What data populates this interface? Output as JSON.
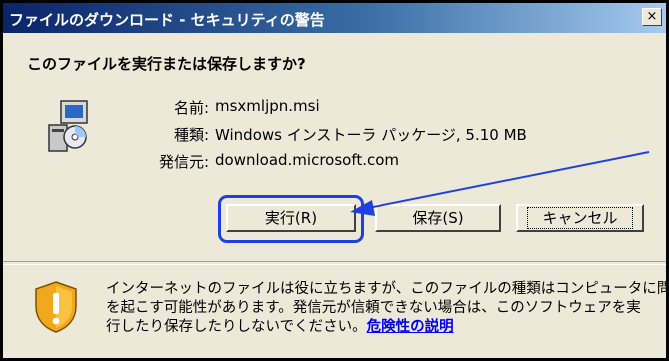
{
  "window": {
    "title": "ファイルのダウンロード - セキュリティの警告",
    "close_label": "×"
  },
  "dialog": {
    "question": "このファイルを実行または保存しますか?",
    "fields": [
      {
        "label": "名前:",
        "value": "msxmljpn.msi"
      },
      {
        "label": "種類:",
        "value": "Windows インストーラ パッケージ, 5.10 MB"
      },
      {
        "label": "発信元:",
        "value": "download.microsoft.com"
      }
    ],
    "icon": "installer-package-icon"
  },
  "buttons": {
    "run": "実行(R)",
    "save": "保存(S)",
    "cancel": "キャンセル"
  },
  "warning": {
    "icon": "security-shield-icon",
    "line1": "インターネットのファイルは役に立ちますが、このファイルの種類はコンピュータに問題",
    "line2": "を起こす可能性があります。発信元が信頼できない場合は、このソフトウェアを実",
    "line3": "行したり保存したりしないでください。",
    "link": "危険性の説明"
  },
  "annotation": {
    "highlight_color": "#1f3fe0"
  }
}
